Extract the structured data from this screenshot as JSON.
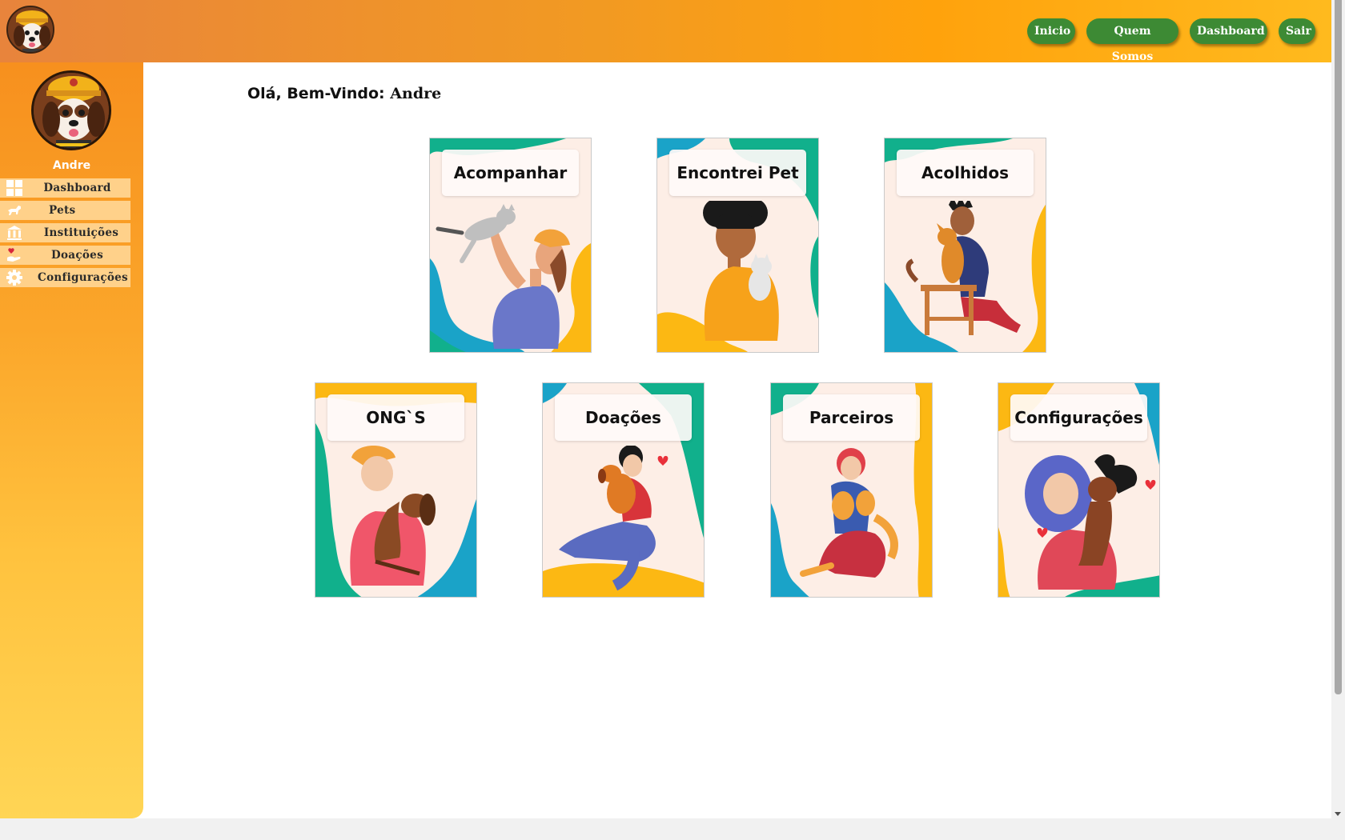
{
  "header": {
    "nav": [
      {
        "label": "Inicio"
      },
      {
        "label": "Quem Somos"
      },
      {
        "label": "Dashboard"
      },
      {
        "label": "Sair"
      }
    ]
  },
  "sidebar": {
    "user_name": "Andre",
    "items": [
      {
        "label": "Dashboard",
        "icon": "grid-icon"
      },
      {
        "label": "Pets",
        "icon": "dog-icon"
      },
      {
        "label": "Instituições",
        "icon": "institution-icon"
      },
      {
        "label": "Doações",
        "icon": "donation-heart-icon"
      },
      {
        "label": "Configurações",
        "icon": "gear-icon"
      }
    ]
  },
  "main": {
    "greeting_prefix": "Olá, Bem-Vindo:",
    "greeting_user": "Andre",
    "cards": [
      {
        "title": "Acompanhar"
      },
      {
        "title": "Encontrei Pet"
      },
      {
        "title": "Acolhidos"
      },
      {
        "title": "ONG`S"
      },
      {
        "title": "Doações"
      },
      {
        "title": "Parceiros"
      },
      {
        "title": "Configurações"
      }
    ]
  },
  "colors": {
    "accent_green": "#3d8a34",
    "header_orange": "#f29a22",
    "card_teal": "#11b08c",
    "card_blue": "#1aa3c8",
    "card_yellow": "#fcb813"
  }
}
